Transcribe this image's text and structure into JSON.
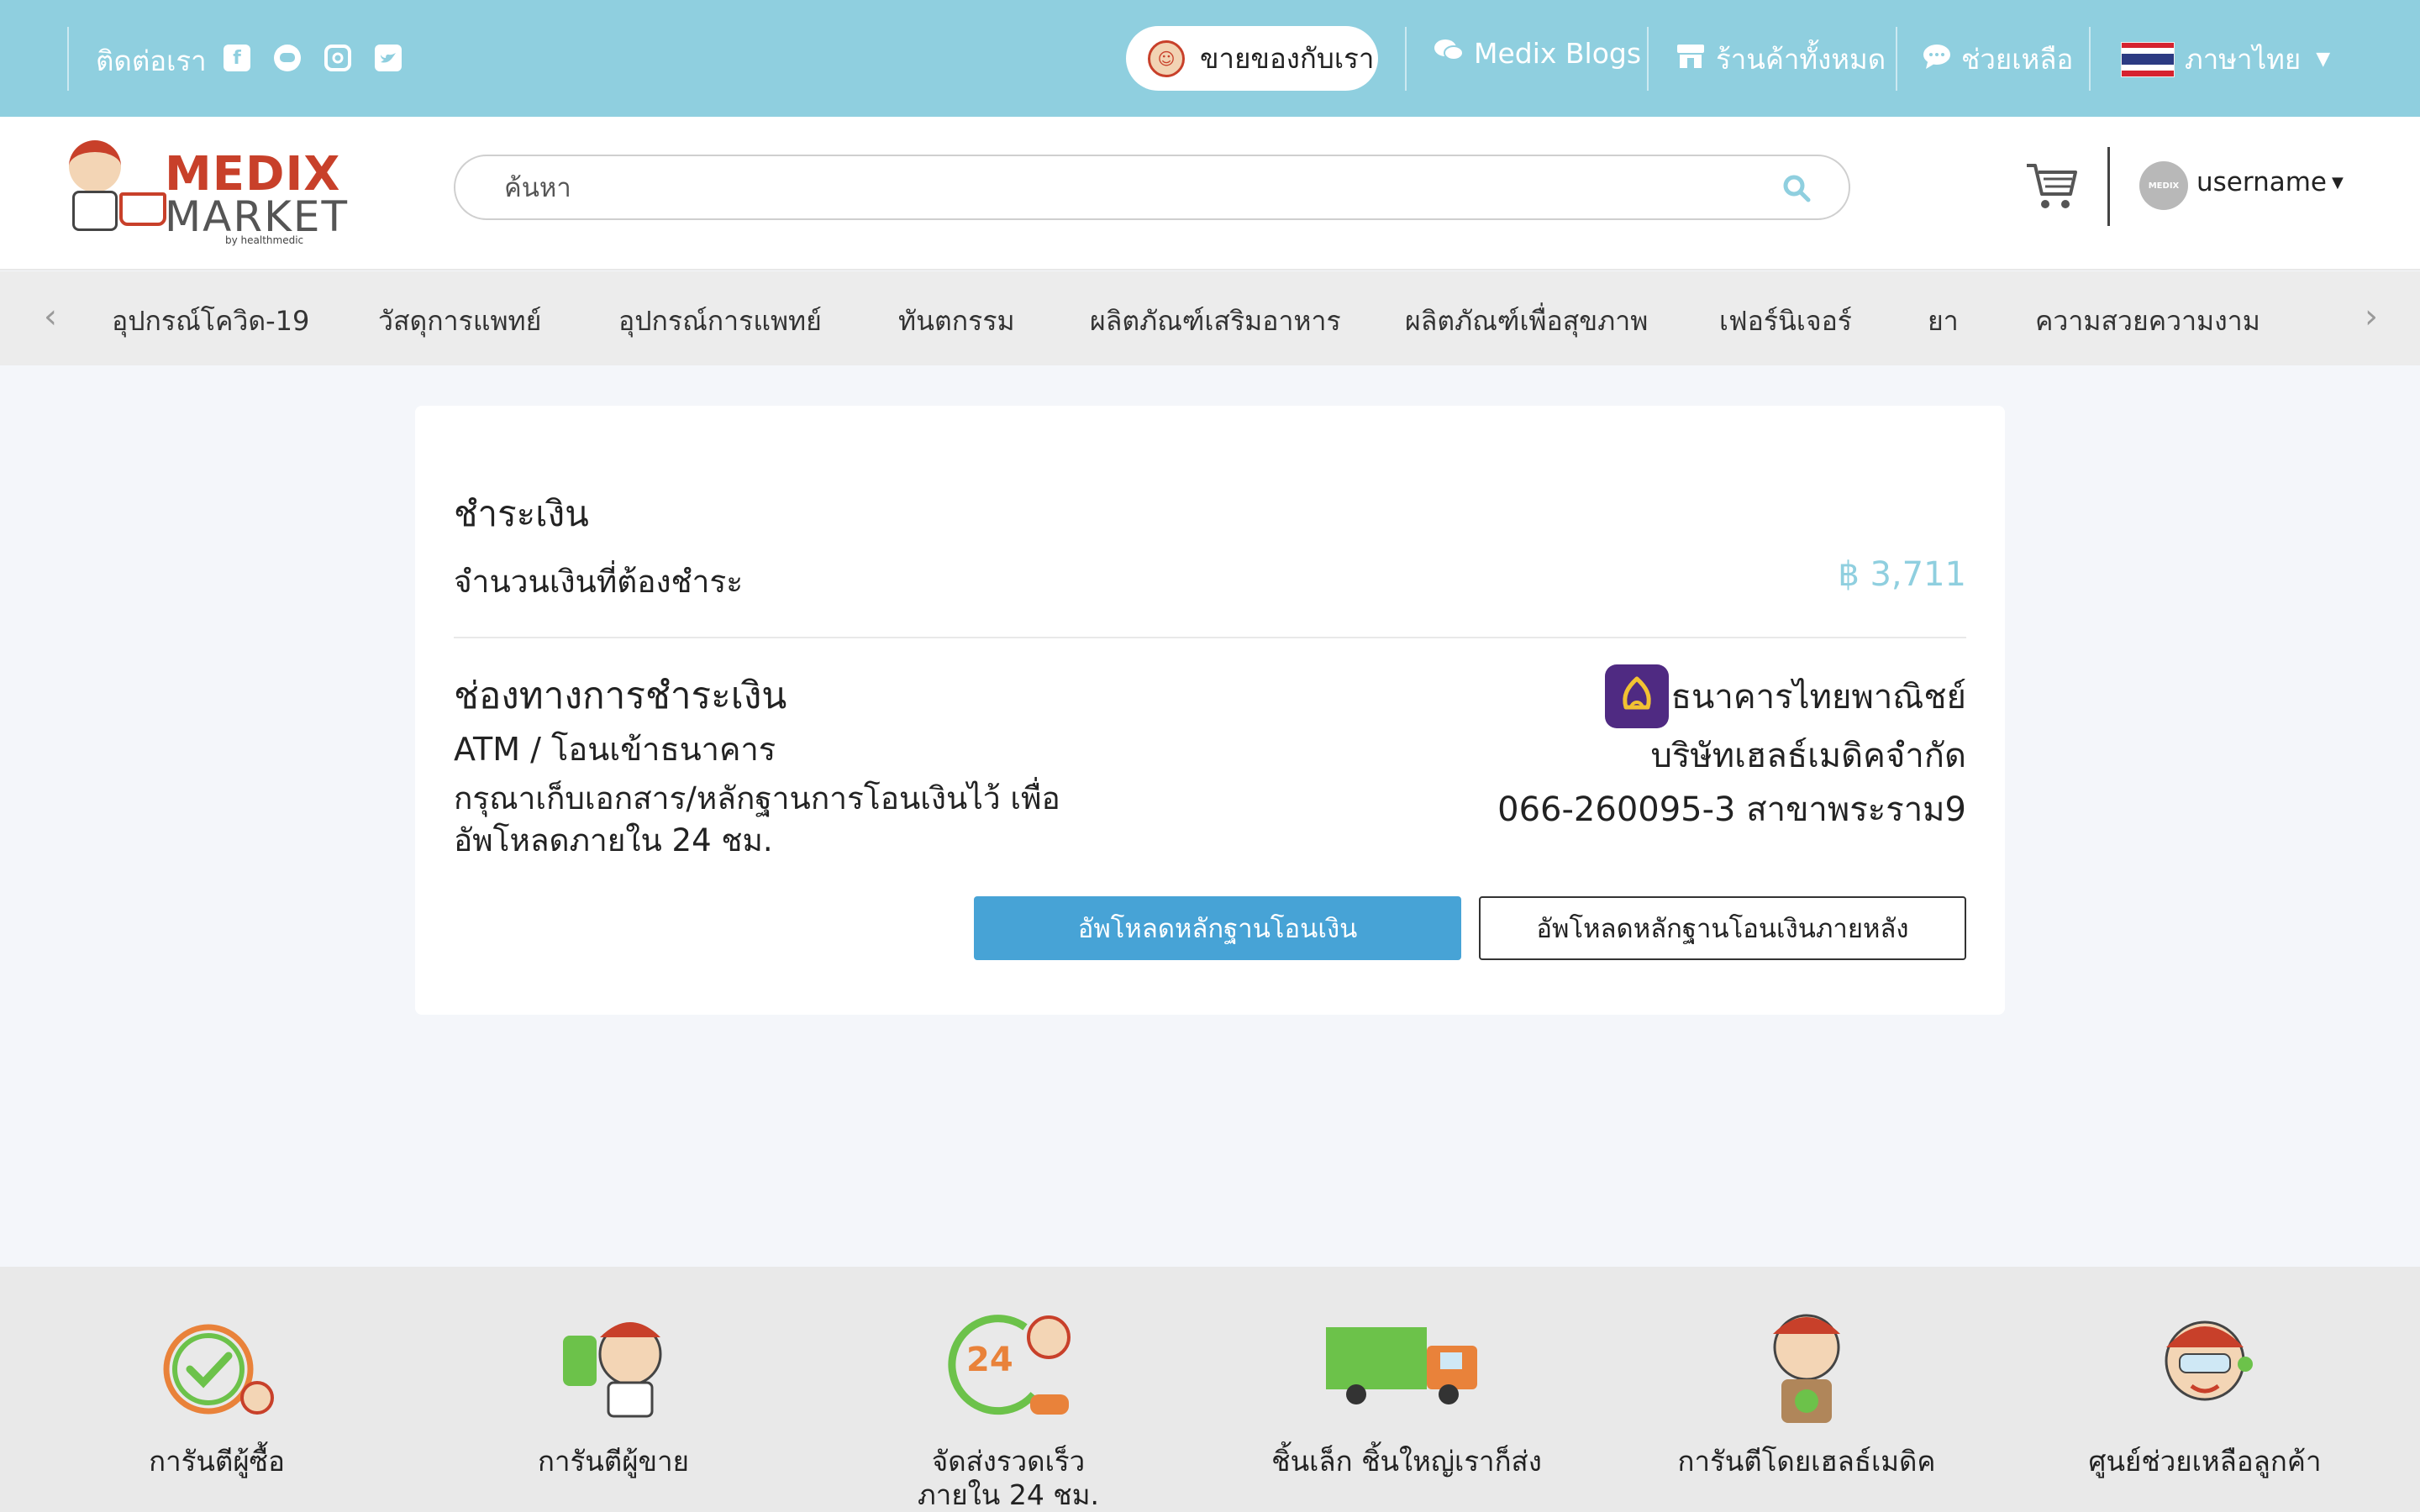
{
  "topbar": {
    "contact_label": "ติดต่อเรา",
    "social_icons": [
      "facebook-icon",
      "line-icon",
      "instagram-icon",
      "twitter-icon"
    ],
    "sell_label": "ขายของกับเรา",
    "links": [
      {
        "label": "Medix Blogs",
        "icon": "chat-bubbles-icon"
      },
      {
        "label": "ร้านค้าทั้งหมด",
        "icon": "store-icon"
      },
      {
        "label": "ช่วยเหลือ",
        "icon": "help-chat-icon"
      }
    ],
    "language_label": "ภาษาไทย",
    "background_color": "#8fcfdf"
  },
  "header": {
    "logo_line1": "MEDIX",
    "logo_line2": "MARKET",
    "logo_tagline": "by healthmedic",
    "search_placeholder": "ค้นหา",
    "username": "username",
    "avatar_text": "MEDIX"
  },
  "categories": [
    "อุปกรณ์โควิด-19",
    "วัสดุการแพทย์",
    "อุปกรณ์การแพทย์",
    "ทันตกรรม",
    "ผลิตภัณฑ์เสริมอาหาร",
    "ผลิตภัณฑ์เพื่อสุขภาพ",
    "เฟอร์นิเจอร์",
    "ยา",
    "ความสวยความงาม"
  ],
  "payment": {
    "title": "ชำระเงิน",
    "amount_label": "จำนวนเงินที่ต้องชำระ",
    "amount": "฿ 3,711",
    "channel_title": "ช่องทางการชำระเงิน",
    "method": "ATM / โอนเข้าธนาคาร",
    "note": "กรุณาเก็บเอกสาร/หลักฐานการโอนเงินไว้ เพื่ออัพโหลดภายใน 24 ชม.",
    "bank_name": "ธนาคารไทยพาณิชย์",
    "company": "บริษัทเฮลธ์เมดิคจำกัด",
    "account": "066-260095-3 สาขาพระราม9",
    "upload_button": "อัพโหลดหลักฐานโอนเงิน",
    "upload_later_button": "อัพโหลดหลักฐานโอนเงินภายหลัง",
    "accent_color": "#8fcfdf",
    "button_color": "#47a3d6",
    "bank_color": "#4f2a82"
  },
  "features": [
    {
      "label": "การันตีผู้ซื้อ",
      "icon": "buyer-guarantee-icon"
    },
    {
      "label": "การันตีผู้ขาย",
      "icon": "seller-guarantee-icon"
    },
    {
      "label": "จัดส่งรวดเร็ว\nภายใน 24 ชม.",
      "icon": "fast-delivery-24h-icon"
    },
    {
      "label": "ชิ้นเล็ก ชิ้นใหญ่เราก็ส่ง",
      "icon": "delivery-truck-icon"
    },
    {
      "label": "การันตีโดยเฮลธ์เมดิค",
      "icon": "healthmedic-guarantee-icon"
    },
    {
      "label": "ศูนย์ช่วยเหลือลูกค้า",
      "icon": "customer-support-icon"
    }
  ]
}
